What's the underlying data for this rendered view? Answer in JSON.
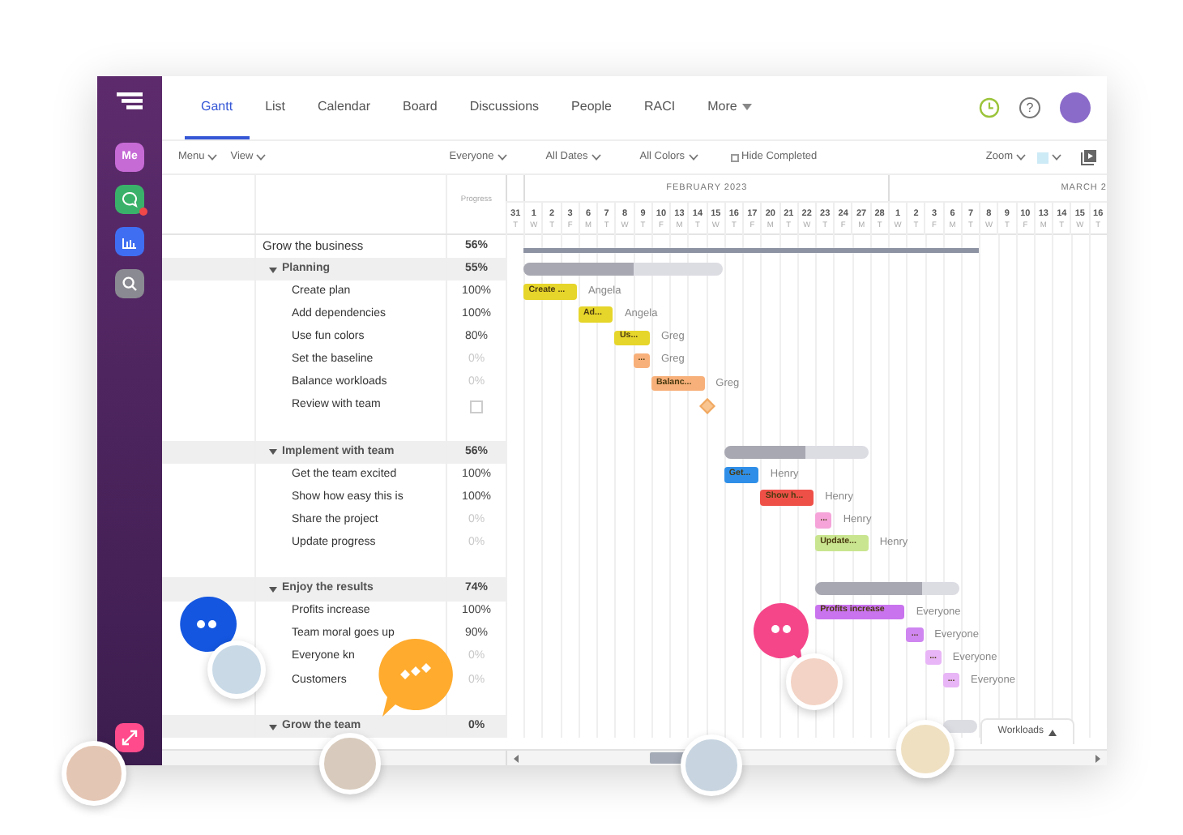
{
  "tabs": [
    {
      "label": "Gantt",
      "selected": true
    },
    {
      "label": "List",
      "selected": false
    },
    {
      "label": "Calendar",
      "selected": false
    },
    {
      "label": "Board",
      "selected": false
    },
    {
      "label": "Discussions",
      "selected": false
    },
    {
      "label": "People",
      "selected": false
    },
    {
      "label": "RACI",
      "selected": false
    },
    {
      "label": "More",
      "selected": false,
      "kind": "menu"
    }
  ],
  "help": "?",
  "sidebar": {
    "me": "Me"
  },
  "toolbar": {
    "menus": [
      {
        "label": "Menu"
      },
      {
        "label": "View"
      }
    ],
    "filters": [
      {
        "label": "Everyone"
      },
      {
        "label": "All Dates"
      },
      {
        "label": "All Colors"
      }
    ],
    "hide_completed": {
      "label": "Hide Completed",
      "checked": false
    },
    "zoom": "Zoom"
  },
  "table": {
    "progress_header": "Progress"
  },
  "timeline": {
    "months": [
      {
        "days": [
          {
            "day": "31",
            "weekday": "T"
          }
        ]
      },
      {
        "label": "FEBRUARY 2023",
        "days": [
          {
            "day": "1",
            "weekday": "W"
          },
          {
            "day": "2",
            "weekday": "T"
          },
          {
            "day": "3",
            "weekday": "F"
          },
          {
            "day": "6",
            "weekday": "M"
          },
          {
            "day": "7",
            "weekday": "T"
          },
          {
            "day": "8",
            "weekday": "W"
          },
          {
            "day": "9",
            "weekday": "T"
          },
          {
            "day": "10",
            "weekday": "F"
          },
          {
            "day": "13",
            "weekday": "M"
          },
          {
            "day": "14",
            "weekday": "T"
          },
          {
            "day": "15",
            "weekday": "W"
          },
          {
            "day": "16",
            "weekday": "T"
          },
          {
            "day": "17",
            "weekday": "F"
          },
          {
            "day": "20",
            "weekday": "M"
          },
          {
            "day": "21",
            "weekday": "T"
          },
          {
            "day": "22",
            "weekday": "W"
          },
          {
            "day": "23",
            "weekday": "T"
          },
          {
            "day": "24",
            "weekday": "F"
          },
          {
            "day": "27",
            "weekday": "M"
          },
          {
            "day": "28",
            "weekday": "T"
          }
        ]
      },
      {
        "label": "MARCH 2",
        "days": [
          {
            "day": "1",
            "weekday": "W"
          },
          {
            "day": "2",
            "weekday": "T"
          },
          {
            "day": "3",
            "weekday": "F"
          },
          {
            "day": "6",
            "weekday": "M"
          },
          {
            "day": "7",
            "weekday": "T"
          },
          {
            "day": "8",
            "weekday": "W"
          },
          {
            "day": "9",
            "weekday": "T"
          },
          {
            "day": "10",
            "weekday": "F"
          },
          {
            "day": "13",
            "weekday": "M"
          },
          {
            "day": "14",
            "weekday": "T"
          },
          {
            "day": "15",
            "weekday": "W"
          },
          {
            "day": "16",
            "weekday": "T"
          }
        ]
      }
    ]
  },
  "project": {
    "name": "Grow the business",
    "progress": "56%",
    "bar": {
      "kind": "line"
    },
    "children": [
      {
        "name": "Planning",
        "progress": "55%",
        "expanded": true,
        "bar": {
          "kind": "summary",
          "level": 0.55
        },
        "children": [
          {
            "kind": "task",
            "name": "Create plan",
            "progress": "100%",
            "started": true,
            "bar": {
              "kind": "task",
              "label": "Create ...",
              "color": "#e6d52a",
              "assignee": "Angela"
            }
          },
          {
            "kind": "task",
            "name": "Add dependencies",
            "progress": "100%",
            "started": true,
            "bar": {
              "kind": "task",
              "label": "Ad...",
              "color": "#e6d52a",
              "assignee": "Angela"
            }
          },
          {
            "kind": "task",
            "name": "Use fun colors",
            "progress": "80%",
            "started": true,
            "bar": {
              "kind": "task",
              "label": "Us...",
              "color": "#e6d52a",
              "assignee": "Greg"
            }
          },
          {
            "kind": "task",
            "name": "Set the baseline",
            "progress": "0%",
            "started": false,
            "bar": {
              "kind": "task",
              "label": "...",
              "color": "#f8b07a",
              "assignee": "Greg"
            }
          },
          {
            "kind": "task",
            "name": "Balance workloads",
            "progress": "0%",
            "started": false,
            "bar": {
              "kind": "task",
              "label": "Balanc...",
              "color": "#f8b07a",
              "assignee": "Greg"
            }
          },
          {
            "kind": "milestone",
            "name": "Review with team",
            "checked": false,
            "bar": {
              "kind": "milestone",
              "color": "#f8c48f"
            }
          }
        ]
      },
      {
        "name": "Implement with team",
        "progress": "56%",
        "expanded": true,
        "bar": {
          "kind": "summary",
          "level": 0.56
        },
        "children": [
          {
            "kind": "task",
            "name": "Get the team excited",
            "progress": "100%",
            "started": true,
            "bar": {
              "kind": "task",
              "label": "Get...",
              "color": "#2f8fe8",
              "assignee": "Henry"
            }
          },
          {
            "kind": "task",
            "name": "Show how easy this is",
            "progress": "100%",
            "started": true,
            "bar": {
              "kind": "task",
              "label": "Show h...",
              "color": "#ee5048",
              "assignee": "Henry"
            }
          },
          {
            "kind": "task",
            "name": "Share the project",
            "progress": "0%",
            "started": false,
            "bar": {
              "kind": "task",
              "label": "...",
              "color": "#f5a3d9",
              "assignee": "Henry"
            }
          },
          {
            "kind": "task",
            "name": "Update progress",
            "progress": "0%",
            "started": false,
            "bar": {
              "kind": "task",
              "label": "Update...",
              "color": "#c9e58f",
              "assignee": "Henry"
            }
          }
        ]
      },
      {
        "name": "Enjoy the results",
        "progress": "74%",
        "expanded": true,
        "bar": {
          "kind": "summary",
          "level": 0.74
        },
        "children": [
          {
            "kind": "task",
            "name": "Profits increase",
            "progress": "100%",
            "started": true,
            "bar": {
              "kind": "task",
              "label": "Profits increase",
              "color": "#c973ee",
              "assignee": "Everyone"
            }
          },
          {
            "kind": "task",
            "name": "Team moral goes up",
            "progress": "90%",
            "started": true,
            "bar": {
              "kind": "task",
              "label": "...",
              "color": "#cf86f0",
              "assignee": "Everyone"
            }
          },
          {
            "kind": "task",
            "name": "Everyone kn",
            "progress": "0%",
            "started": false,
            "bar": {
              "kind": "task",
              "label": "...",
              "color": "#e8b5f6",
              "assignee": "Everyone"
            }
          },
          {
            "kind": "task",
            "name": "Customers",
            "progress": "0%",
            "started": false,
            "bar": {
              "kind": "task",
              "label": "...",
              "color": "#e8b5f6",
              "assignee": "Everyone"
            }
          }
        ]
      },
      {
        "name": "Grow the team",
        "progress": "0%",
        "expanded": true,
        "bar": {
          "kind": "summary",
          "level": 0
        }
      }
    ]
  },
  "workloads": {
    "label": "Workloads"
  }
}
